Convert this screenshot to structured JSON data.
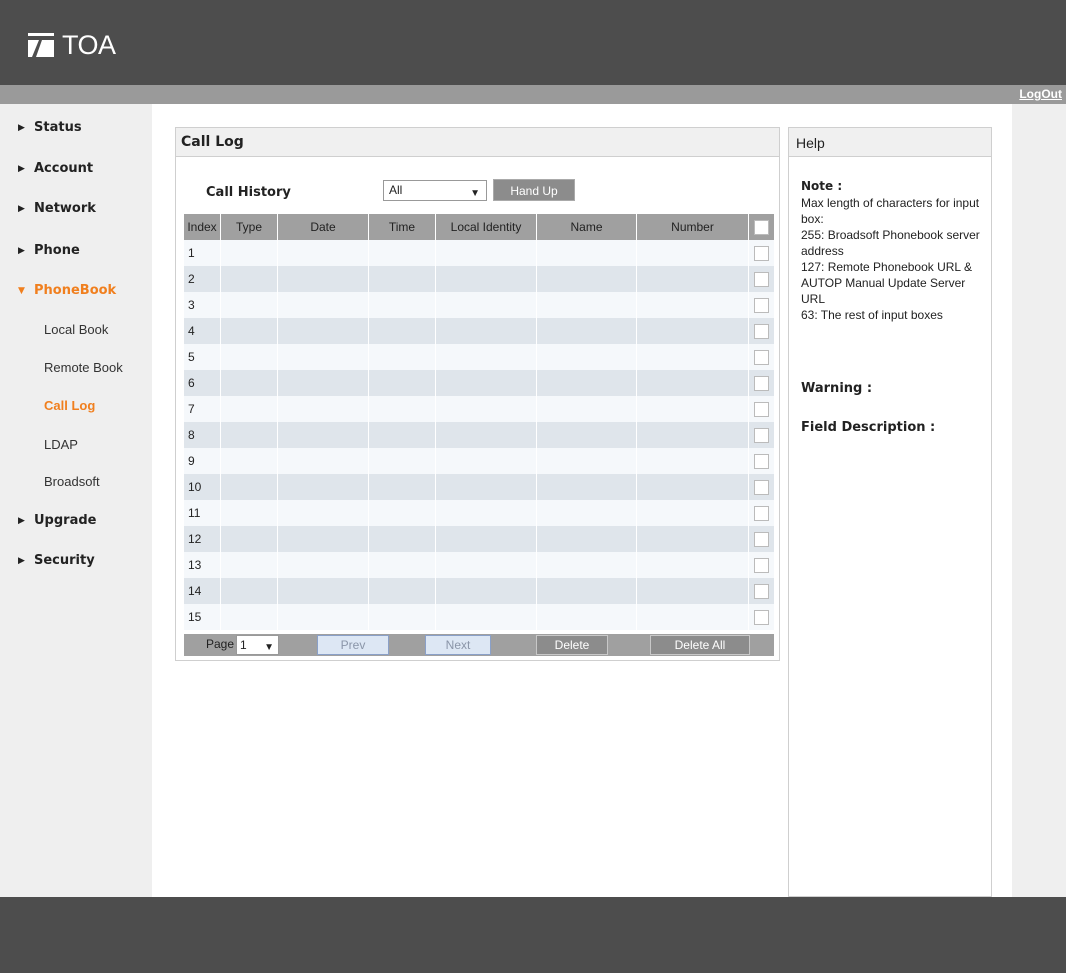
{
  "brand": {
    "name": "TOA"
  },
  "header": {
    "logout": "LogOut"
  },
  "sidebar": {
    "items": [
      {
        "label": "Status",
        "active": false
      },
      {
        "label": "Account",
        "active": false
      },
      {
        "label": "Network",
        "active": false
      },
      {
        "label": "Phone",
        "active": false
      },
      {
        "label": "PhoneBook",
        "active": true,
        "expanded": true
      },
      {
        "label": "Upgrade",
        "active": false
      },
      {
        "label": "Security",
        "active": false
      }
    ],
    "subitems": [
      {
        "label": "Local Book",
        "active": false
      },
      {
        "label": "Remote Book",
        "active": false
      },
      {
        "label": "Call Log",
        "active": true
      },
      {
        "label": "LDAP",
        "active": false
      },
      {
        "label": "Broadsoft",
        "active": false
      }
    ]
  },
  "panel": {
    "title": "Call Log",
    "call_history_label": "Call History",
    "filter_value": "All",
    "hand_up": "Hand Up",
    "columns": [
      "Index",
      "Type",
      "Date",
      "Time",
      "Local Identity",
      "Name",
      "Number"
    ],
    "rows": [
      "1",
      "2",
      "3",
      "4",
      "5",
      "6",
      "7",
      "8",
      "9",
      "10",
      "11",
      "12",
      "13",
      "14",
      "15"
    ],
    "pager": {
      "page_label": "Page",
      "page_value": "1",
      "prev": "Prev",
      "next": "Next",
      "delete": "Delete",
      "delete_all": "Delete All"
    }
  },
  "help": {
    "title": "Help",
    "note_head": "Note :",
    "note_lines": [
      "Max length of characters for input box:",
      "255: Broadsoft Phonebook server address",
      "127: Remote Phonebook URL & AUTOP Manual Update Server URL",
      "63: The rest of input boxes"
    ],
    "warning": "Warning :",
    "field_description": "Field Description :"
  },
  "colors": {
    "header": "#4d4d4d",
    "accent": "#f07f1e",
    "row_light": "#f5f8fb",
    "row_dark": "#dfe5eb",
    "table_header": "#a0a0a0"
  }
}
